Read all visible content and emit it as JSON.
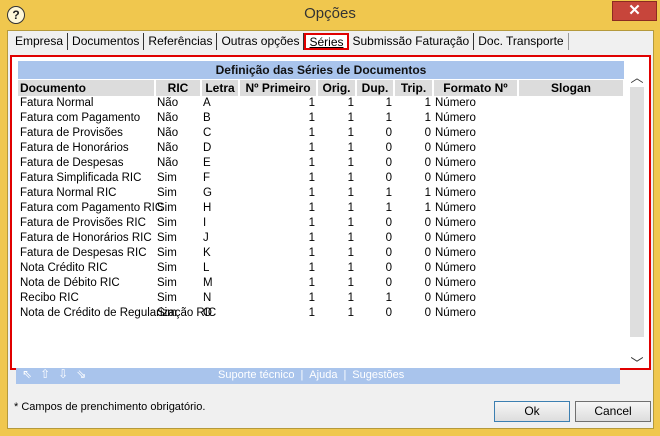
{
  "window": {
    "title": "Opções",
    "close_glyph": "✕",
    "app_icon_glyph": "?"
  },
  "tabs": [
    {
      "label": "Empresa"
    },
    {
      "label": "Documentos"
    },
    {
      "label": "Referências"
    },
    {
      "label": "Outras opções"
    },
    {
      "label": "Séries",
      "active": true
    },
    {
      "label": "Submissão Faturação"
    },
    {
      "label": "Doc. Transporte"
    }
  ],
  "grid": {
    "caption": "Definição das Séries de Documentos",
    "columns": [
      "Documento",
      "RIC",
      "Letra",
      "Nº Primeiro",
      "Orig.",
      "Dup.",
      "Trip.",
      "Formato Nº",
      "Slogan"
    ],
    "rows": [
      [
        "Fatura Normal",
        "Não",
        "A",
        "1",
        "1",
        "1",
        "1",
        "Número",
        ""
      ],
      [
        "Fatura com Pagamento",
        "Não",
        "B",
        "1",
        "1",
        "1",
        "1",
        "Número",
        ""
      ],
      [
        "Fatura de Provisões",
        "Não",
        "C",
        "1",
        "1",
        "0",
        "0",
        "Número",
        ""
      ],
      [
        "Fatura de Honorários",
        "Não",
        "D",
        "1",
        "1",
        "0",
        "0",
        "Número",
        ""
      ],
      [
        "Fatura de Despesas",
        "Não",
        "E",
        "1",
        "1",
        "0",
        "0",
        "Número",
        ""
      ],
      [
        "Fatura Simplificada RIC",
        "Sim",
        "F",
        "1",
        "1",
        "0",
        "0",
        "Número",
        ""
      ],
      [
        "Fatura Normal RIC",
        "Sim",
        "G",
        "1",
        "1",
        "1",
        "1",
        "Número",
        ""
      ],
      [
        "Fatura com Pagamento RIC",
        "Sim",
        "H",
        "1",
        "1",
        "1",
        "1",
        "Número",
        ""
      ],
      [
        "Fatura de Provisões RIC",
        "Sim",
        "I",
        "1",
        "1",
        "0",
        "0",
        "Número",
        ""
      ],
      [
        "Fatura de Honorários RIC",
        "Sim",
        "J",
        "1",
        "1",
        "0",
        "0",
        "Número",
        ""
      ],
      [
        "Fatura de Despesas RIC",
        "Sim",
        "K",
        "1",
        "1",
        "0",
        "0",
        "Número",
        ""
      ],
      [
        "Nota Crédito RIC",
        "Sim",
        "L",
        "1",
        "1",
        "0",
        "0",
        "Número",
        ""
      ],
      [
        "Nota de Débito RIC",
        "Sim",
        "M",
        "1",
        "1",
        "0",
        "0",
        "Número",
        ""
      ],
      [
        "Recibo RIC",
        "Sim",
        "N",
        "1",
        "1",
        "1",
        "0",
        "Número",
        ""
      ],
      [
        "Nota de Crédito de Regularização RIC",
        "Sim",
        "O",
        "1",
        "1",
        "0",
        "0",
        "Número",
        ""
      ]
    ]
  },
  "scroll": {
    "up_glyph": "︿",
    "down_glyph": "﹀"
  },
  "footer": {
    "arrows": [
      "⇖",
      "⇧",
      "⇩",
      "⇘"
    ],
    "links": [
      "Suporte técnico",
      "Ajuda",
      "Sugestões"
    ],
    "separator": "|"
  },
  "required_note": "* Campos de prenchimento obrigatório.",
  "buttons": {
    "ok": "Ok",
    "cancel": "Cancel"
  }
}
